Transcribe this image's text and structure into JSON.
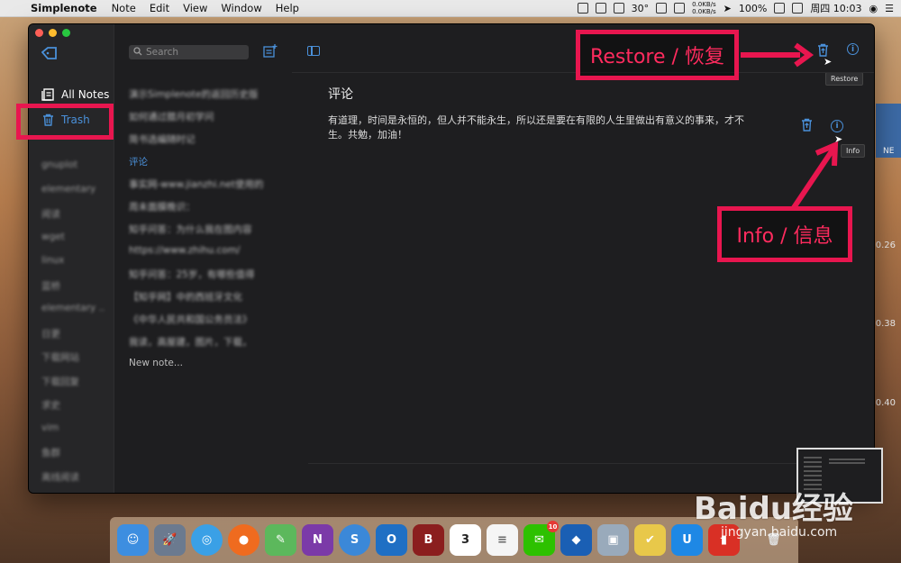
{
  "menubar": {
    "app": "Simplenote",
    "items": [
      "Note",
      "Edit",
      "View",
      "Window",
      "Help"
    ],
    "temperature": "30°",
    "net_up": "0.0KB/s",
    "net_down": "0.0KB/s",
    "battery": "100%",
    "clock": "周四 10:03"
  },
  "sidebar": {
    "all_notes": "All Notes",
    "trash": "Trash",
    "tags": [
      "gnuplot",
      "elementary",
      "阅读",
      "wget",
      "linux",
      "蓝桥",
      "elementary ...",
      "日更",
      "下载网站",
      "下载回复",
      "求史",
      "vim",
      "鱼群",
      "离线阅读"
    ]
  },
  "list": {
    "search_placeholder": "Search",
    "notes": [
      "演示Simplenote的返回历史版",
      "如何通过腊月初学问",
      "简书选编随时记",
      "评论",
      "事实网-www.jianzhi.net使用的",
      "周未面膜晚识：",
      "知乎问答：为什么我在图内容",
      "https://www.zhihu.com/",
      "知乎问答：25岁，有哪些值得",
      "【知乎网】中的西班牙文化",
      "《中华人民共和国公务员法》",
      "我读，高屋建，图片，下载，",
      "New note..."
    ]
  },
  "editor": {
    "title": "评论",
    "body": "有道理，时间是永恒的，但人并不能永生，所以还是要在有限的人生里做出有意义的事来，才不\n生。共勉，加油！",
    "tooltip_restore": "Restore",
    "tooltip_info": "Info"
  },
  "annotations": {
    "restore_label": "Restore / 恢复",
    "info_label": "Info / 信息"
  },
  "background": {
    "peek_text": "NE",
    "numbers": [
      "0.26",
      "0.38",
      "0.40"
    ]
  },
  "dock": {
    "wechat_badge": "10",
    "calendar_date": "3"
  },
  "watermark": {
    "text": "Baidu经验",
    "url": "jingyan.baidu.com"
  },
  "colors": {
    "accent": "#4a90d9",
    "annotation": "#e8164f"
  }
}
